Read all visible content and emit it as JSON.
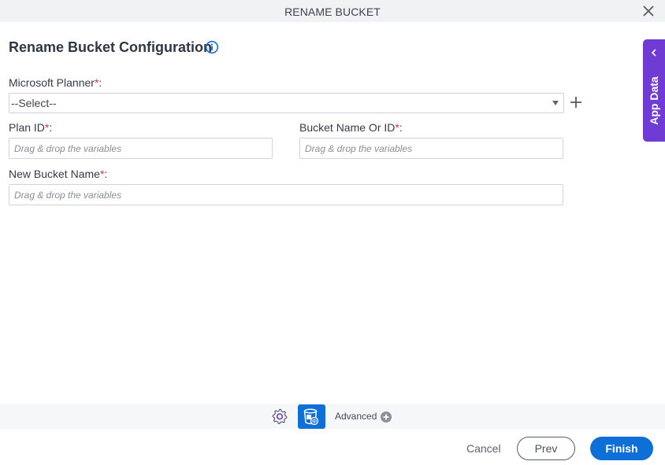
{
  "window": {
    "title": "RENAME BUCKET",
    "close_icon": "close-icon"
  },
  "form": {
    "heading": "Rename Bucket Configuration",
    "info_icon": "info-icon",
    "microsoft_planner": {
      "label": "Microsoft Planner",
      "required_mark": "*",
      "suffix": ":",
      "selected": "--Select--",
      "add_icon": "plus-icon"
    },
    "plan_id": {
      "label": "Plan ID",
      "required_mark": "*",
      "suffix": ":",
      "placeholder": "Drag & drop the variables",
      "value": ""
    },
    "bucket_name_or_id": {
      "label": "Bucket Name Or ID",
      "required_mark": "*",
      "suffix": ":",
      "placeholder": "Drag & drop the variables",
      "value": ""
    },
    "new_bucket_name": {
      "label": "New Bucket Name",
      "required_mark": "*",
      "suffix": ":",
      "placeholder": "Drag & drop the variables",
      "value": ""
    }
  },
  "side_panel": {
    "label": "App Data",
    "icon": "chevron-left-icon"
  },
  "toolbar": {
    "settings_icon": "gear-icon",
    "bucket_icon": "bucket-icon",
    "advanced_label": "Advanced",
    "advanced_icon": "plus-circle-icon"
  },
  "footer": {
    "cancel_label": "Cancel",
    "prev_label": "Prev",
    "finish_label": "Finish"
  },
  "colors": {
    "accent": "#0f6fd8",
    "side_panel": "#6f3bd4",
    "required": "#d0343c"
  }
}
